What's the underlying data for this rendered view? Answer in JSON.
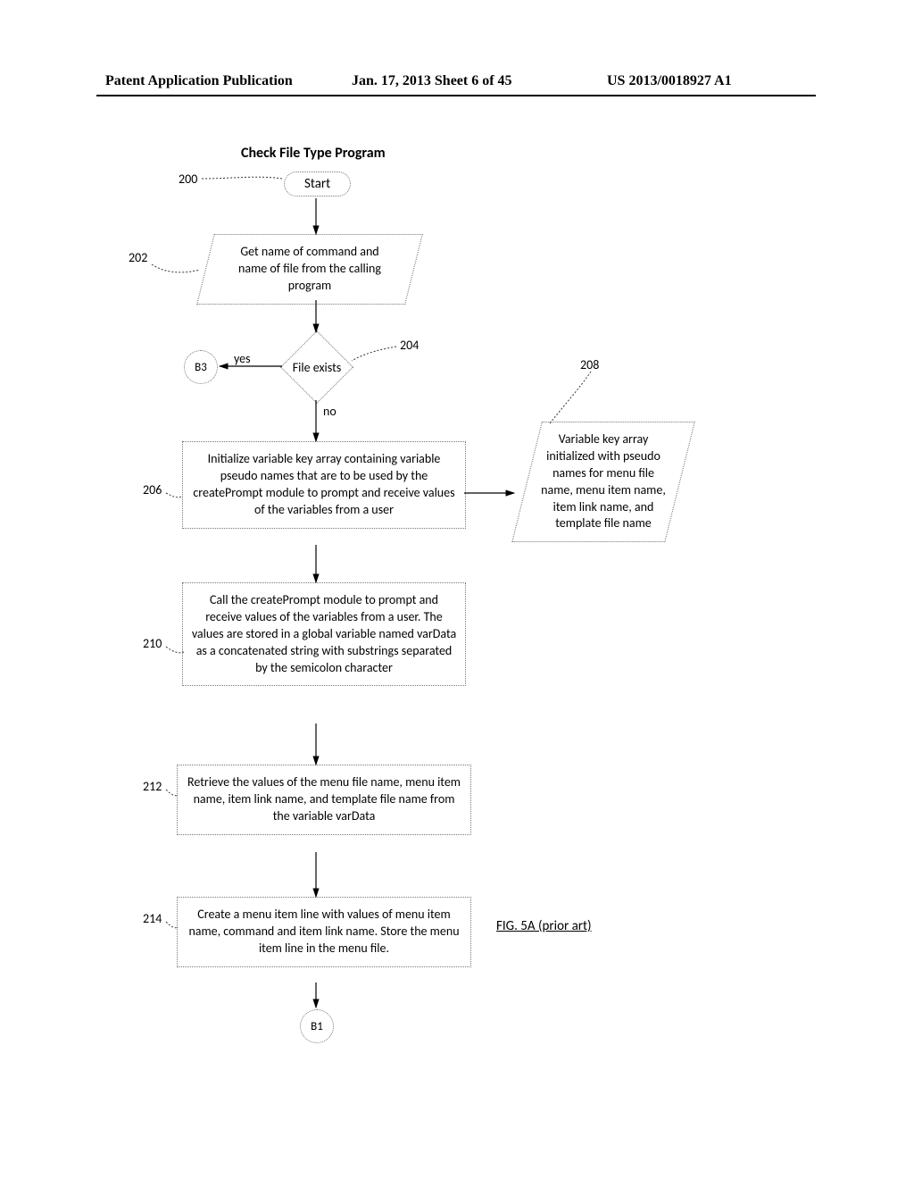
{
  "header": {
    "left": "Patent Application Publication",
    "mid": "Jan. 17, 2013  Sheet 6 of 45",
    "right": "US 2013/0018927 A1"
  },
  "flow": {
    "title": "Check File Type Program",
    "start": "Start",
    "step202": "Get name of command and name of file from the calling program",
    "dec204": "File exists",
    "dec_yes": "yes",
    "dec_no": "no",
    "conn_b3": "B3",
    "step206": "Initialize variable key array containing variable pseudo names that are to be used by the createPrompt module to prompt and receive values of the variables from a user",
    "note208": "Variable key array initialized with pseudo names for menu file name, menu item name, item link name, and template file name",
    "step210": "Call the createPrompt module to prompt and receive values of the variables from a user.  The values are stored in a global variable named varData as a concatenated string with substrings separated by the semicolon character",
    "step212": "Retrieve the values of the menu file name, menu item name, item link name, and template file name from the variable varData",
    "step214": "Create a menu item line with values of menu item name, command and item link name. Store the menu item line in the menu file.",
    "conn_b1": "B1"
  },
  "refs": {
    "n200": "200",
    "n202": "202",
    "n204": "204",
    "n206": "206",
    "n208": "208",
    "n210": "210",
    "n212": "212",
    "n214": "214"
  },
  "figure_caption": "FIG. 5A (prior art)",
  "chart_data": {
    "type": "flowchart",
    "title": "Check File Type Program",
    "nodes": [
      {
        "id": "200",
        "shape": "terminator",
        "label": "Start"
      },
      {
        "id": "202",
        "shape": "parallelogram",
        "label": "Get name of command and name of file from the calling program"
      },
      {
        "id": "204",
        "shape": "decision",
        "label": "File exists"
      },
      {
        "id": "B3",
        "shape": "connector",
        "label": "B3"
      },
      {
        "id": "206",
        "shape": "process",
        "label": "Initialize variable key array containing variable pseudo names that are to be used by the createPrompt module to prompt and receive values of the variables from a user"
      },
      {
        "id": "208",
        "shape": "annotation",
        "label": "Variable key array initialized with pseudo names for menu file name, menu item name, item link name, and template file name"
      },
      {
        "id": "210",
        "shape": "process",
        "label": "Call the createPrompt module to prompt and receive values of the variables from a user. The values are stored in a global variable named varData as a concatenated string with substrings separated by the semicolon character"
      },
      {
        "id": "212",
        "shape": "process",
        "label": "Retrieve the values of the menu file name, menu item name, item link name, and template file name from the variable varData"
      },
      {
        "id": "214",
        "shape": "process",
        "label": "Create a menu item line with values of menu item name, command and item link name. Store the menu item line in the menu file."
      },
      {
        "id": "B1",
        "shape": "connector",
        "label": "B1"
      }
    ],
    "edges": [
      {
        "from": "200",
        "to": "202"
      },
      {
        "from": "202",
        "to": "204"
      },
      {
        "from": "204",
        "to": "B3",
        "label": "yes"
      },
      {
        "from": "204",
        "to": "206",
        "label": "no"
      },
      {
        "from": "206",
        "to": "208",
        "style": "annotation"
      },
      {
        "from": "206",
        "to": "210"
      },
      {
        "from": "210",
        "to": "212"
      },
      {
        "from": "212",
        "to": "214"
      },
      {
        "from": "214",
        "to": "B1"
      }
    ]
  }
}
